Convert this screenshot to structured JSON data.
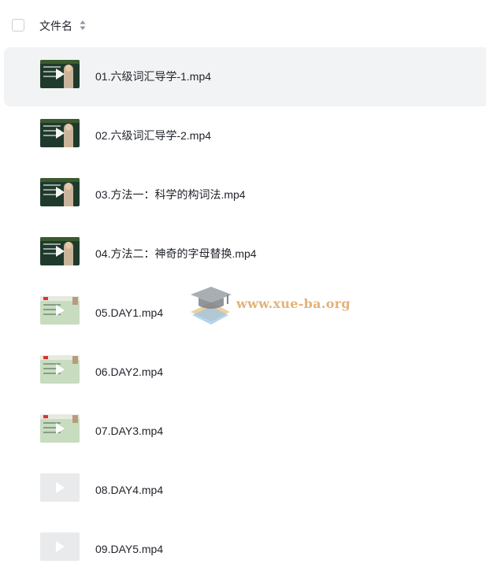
{
  "header": {
    "column_title": "文件名"
  },
  "files": [
    {
      "name": "01.六级词汇导学-1.mp4",
      "thumb": "dark",
      "selected": true
    },
    {
      "name": "02.六级词汇导学-2.mp4",
      "thumb": "dark",
      "selected": false
    },
    {
      "name": "03.方法一：科学的构词法.mp4",
      "thumb": "dark",
      "selected": false
    },
    {
      "name": "04.方法二：神奇的字母替换.mp4",
      "thumb": "dark",
      "selected": false
    },
    {
      "name": "05.DAY1.mp4",
      "thumb": "light",
      "selected": false
    },
    {
      "name": "06.DAY2.mp4",
      "thumb": "light",
      "selected": false
    },
    {
      "name": "07.DAY3.mp4",
      "thumb": "light",
      "selected": false
    },
    {
      "name": "08.DAY4.mp4",
      "thumb": "blank",
      "selected": false
    },
    {
      "name": "09.DAY5.mp4",
      "thumb": "blank",
      "selected": false
    }
  ],
  "icons": {
    "checkbox": "checkbox-icon",
    "sort": "sort-icon",
    "play": "play-icon",
    "watermark_logo": "graduation-cap-icon"
  },
  "watermark": {
    "text": "www.xue-ba.org"
  },
  "colors": {
    "selected_row": "#f2f3f5",
    "text": "#1f2329",
    "watermark": "#e3b278"
  }
}
